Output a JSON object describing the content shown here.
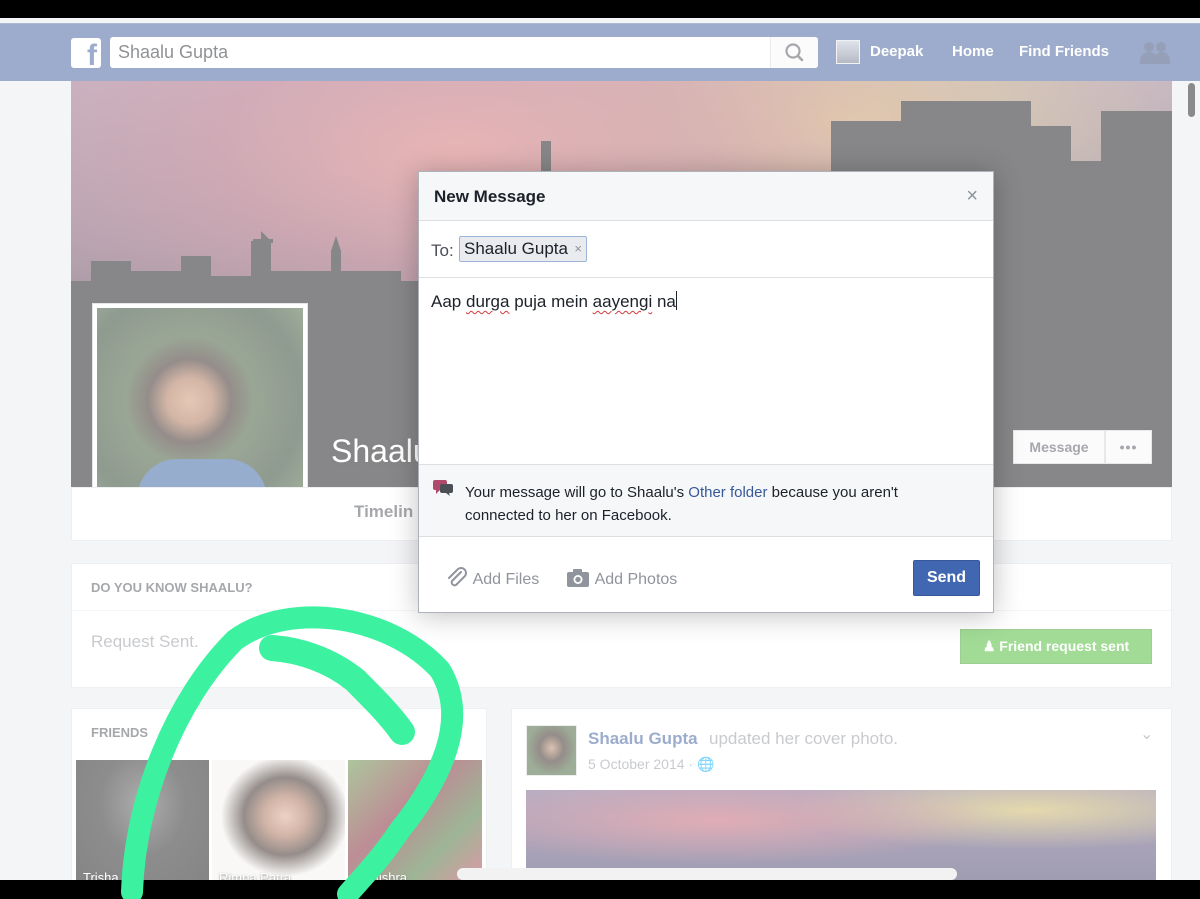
{
  "topnav": {
    "search_value": "Shaalu Gupta",
    "user_name": "Deepak",
    "home_label": "Home",
    "find_friends_label": "Find Friends"
  },
  "profile": {
    "name": "Shaalu",
    "message_button": "Message",
    "more_button": "•••",
    "tab_timeline": "Timelin"
  },
  "know_card": {
    "heading": "DO YOU KNOW SHAALU?",
    "status": "Request Sent.",
    "friend_request_button": "Friend request sent"
  },
  "friends_card": {
    "heading": "FRIENDS",
    "items": [
      {
        "name": "Trisha    ha"
      },
      {
        "name": "Rimpa Patra"
      },
      {
        "name": "N      Mishra"
      }
    ]
  },
  "post": {
    "author": "Shaalu Gupta",
    "action": "updated her cover photo.",
    "date": "5 October 2014 ·"
  },
  "modal": {
    "title": "New Message",
    "close": "×",
    "to_label": "To:",
    "recipient": "Shaalu Gupta",
    "recipient_remove": "×",
    "message_words": [
      "Aap",
      "durga",
      "puja",
      "mein",
      "aayengi",
      "na"
    ],
    "notice_before": "Your message will go to Shaalu's",
    "notice_link": "Other folder",
    "notice_after": "because you aren't connected to her on Facebook.",
    "add_files": "Add Files",
    "add_photos": "Add Photos",
    "send": "Send"
  },
  "colors": {
    "nav_blue": "#3b5998",
    "send_blue": "#4267b2",
    "green_button": "#42b72a",
    "annotation": "#3cf2a0"
  }
}
